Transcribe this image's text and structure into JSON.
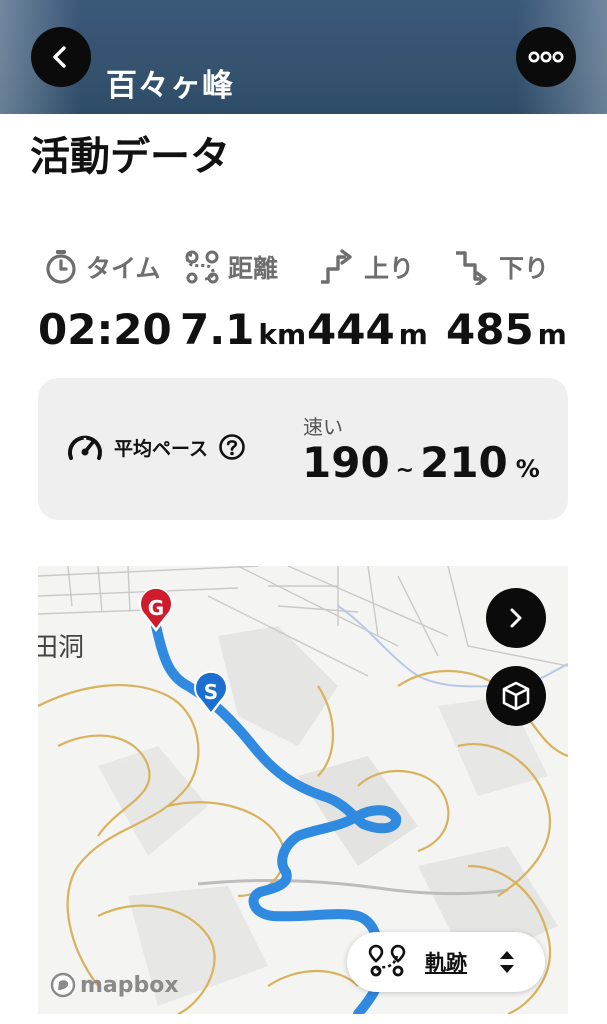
{
  "header": {
    "title": "百々ヶ峰",
    "back_icon": "chevron-left-icon",
    "more_icon": "more-horizontal-icon"
  },
  "section_title": "活動データ",
  "stats": {
    "time": {
      "label": "タイム",
      "value": "02:20",
      "icon": "stopwatch-icon"
    },
    "distance": {
      "label": "距離",
      "value": "7.1",
      "unit": "km",
      "icon": "route-icon"
    },
    "ascent": {
      "label": "上り",
      "value": "444",
      "unit": "m",
      "icon": "ascent-arrow-icon"
    },
    "descent": {
      "label": "下り",
      "value": "485",
      "unit": "m",
      "icon": "descent-arrow-icon"
    }
  },
  "pace": {
    "label": "平均ペース",
    "qualifier": "速い",
    "min": "190",
    "separator": "~",
    "max": "210",
    "unit": "%"
  },
  "map": {
    "place_label": "田洞",
    "goal_marker": "G",
    "start_marker": "S",
    "attribution": "mapbox",
    "layer_selector_label": "軌跡",
    "colors": {
      "track": "#2f8ae0",
      "goal": "#d01c2a",
      "start": "#1a6fd0",
      "contour": "#d8b25c"
    }
  }
}
